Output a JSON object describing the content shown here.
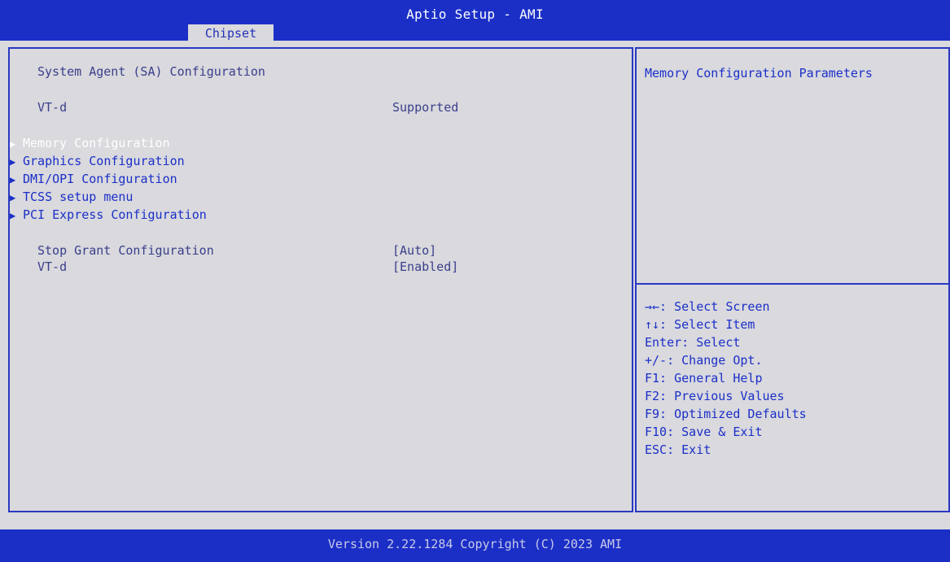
{
  "header": {
    "title": "Aptio Setup - AMI",
    "active_tab": "Chipset"
  },
  "left": {
    "section_title": "System Agent (SA) Configuration",
    "vtd_info": {
      "label": "VT-d",
      "value": "Supported"
    },
    "submenus": [
      {
        "label": "Memory Configuration",
        "selected": true
      },
      {
        "label": "Graphics Configuration",
        "selected": false
      },
      {
        "label": "DMI/OPI Configuration",
        "selected": false
      },
      {
        "label": "TCSS setup menu",
        "selected": false
      },
      {
        "label": "PCI Express Configuration",
        "selected": false
      }
    ],
    "options": [
      {
        "label": "Stop Grant Configuration",
        "value": "[Auto]"
      },
      {
        "label": "VT-d",
        "value": "[Enabled]"
      }
    ]
  },
  "right": {
    "help_description": "Memory Configuration Parameters",
    "keys": [
      "→←: Select Screen",
      "↑↓: Select Item",
      "Enter: Select",
      "+/-: Change Opt.",
      "F1: General Help",
      "F2: Previous Values",
      "F9: Optimized Defaults",
      "F10: Save & Exit",
      "ESC: Exit"
    ]
  },
  "footer": {
    "text": "Version 2.22.1284 Copyright (C) 2023 AMI"
  },
  "colors": {
    "accent_blue": "#1b2fc7",
    "background": "#d9d9de",
    "selected_text": "#ffffff"
  },
  "icons": {
    "submenu_arrow": "triangle-right-icon"
  }
}
